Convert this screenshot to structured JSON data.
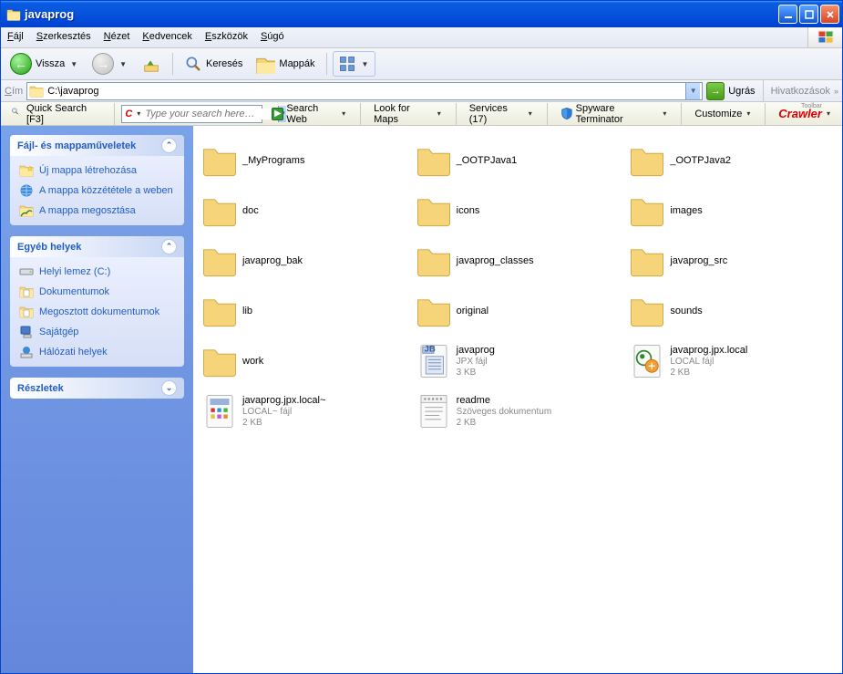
{
  "window": {
    "title": "javaprog"
  },
  "menu": [
    "Fájl",
    "Szerkesztés",
    "Nézet",
    "Kedvencek",
    "Eszközök",
    "Súgó"
  ],
  "toolbar": {
    "back": "Vissza",
    "search": "Keresés",
    "folders": "Mappák"
  },
  "address": {
    "label": "Cím",
    "path": "C:\\javaprog",
    "go": "Ugrás",
    "links": "Hivatkozások"
  },
  "crawler": {
    "quicksearch": "Quick Search [F3]",
    "placeholder": "Type your search here…",
    "searchweb": "Search Web",
    "maps": "Look for Maps",
    "services": "Services (17)",
    "spyware": "Spyware Terminator",
    "customize": "Customize",
    "brand": "Crawler"
  },
  "sidebar": {
    "panel1": {
      "title": "Fájl- és mappaműveletek",
      "items": [
        "Új mappa létrehozása",
        "A mappa közzététele a weben",
        "A mappa megosztása"
      ]
    },
    "panel2": {
      "title": "Egyéb helyek",
      "items": [
        "Helyi lemez (C:)",
        "Dokumentumok",
        "Megosztott dokumentumok",
        "Sajátgép",
        "Hálózati helyek"
      ]
    },
    "panel3": {
      "title": "Részletek"
    }
  },
  "items": [
    {
      "name": "_MyPrograms",
      "type": "folder"
    },
    {
      "name": "_OOTPJava1",
      "type": "folder"
    },
    {
      "name": "_OOTPJava2",
      "type": "folder"
    },
    {
      "name": "doc",
      "type": "folder"
    },
    {
      "name": "icons",
      "type": "folder"
    },
    {
      "name": "images",
      "type": "folder"
    },
    {
      "name": "javaprog_bak",
      "type": "folder"
    },
    {
      "name": "javaprog_classes",
      "type": "folder"
    },
    {
      "name": "javaprog_src",
      "type": "folder"
    },
    {
      "name": "lib",
      "type": "folder"
    },
    {
      "name": "original",
      "type": "folder"
    },
    {
      "name": "sounds",
      "type": "folder"
    },
    {
      "name": "work",
      "type": "folder"
    },
    {
      "name": "javaprog",
      "type": "jpx",
      "desc": "JPX fájl",
      "size": "3 KB"
    },
    {
      "name": "javaprog.jpx.local",
      "type": "local",
      "desc": "LOCAL fájl",
      "size": "2 KB"
    },
    {
      "name": "javaprog.jpx.local~",
      "type": "localt",
      "desc": "LOCAL~ fájl",
      "size": "2 KB"
    },
    {
      "name": "readme",
      "type": "txt",
      "desc": "Szöveges dokumentum",
      "size": "2 KB"
    }
  ]
}
